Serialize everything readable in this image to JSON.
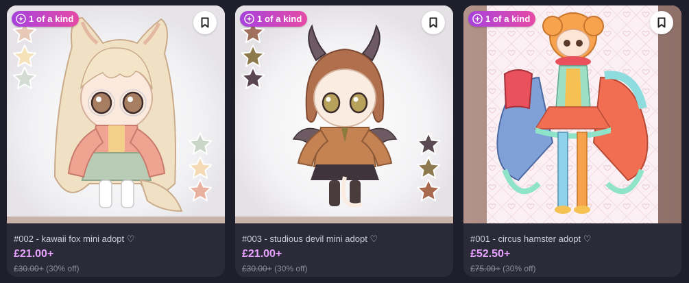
{
  "theme": {
    "background": "#1f1e2b",
    "card": "#2b2a38",
    "price_color": "#e7a3ff",
    "badge_gradient_start": "#a742dc",
    "badge_gradient_end": "#e64ba6"
  },
  "listings": [
    {
      "badge": "1 of a kind",
      "badge_icon": "sparkle-icon",
      "save_icon": "bookmark-icon",
      "title": "#002 - kawaii fox mini adopt ♡",
      "price": "£21.00+",
      "original_price": "£30.00+",
      "discount": "(30% off)",
      "thumbnail": "kawaii fox character illustration",
      "swatch_colors": [
        "#e8c9b8",
        "#f6e2b9",
        "#d3dbd2",
        "#c9d6c8",
        "#f6d9b5",
        "#e9b2a0"
      ]
    },
    {
      "badge": "1 of a kind",
      "badge_icon": "sparkle-icon",
      "save_icon": "bookmark-icon",
      "title": "#003 - studious devil mini adopt ♡",
      "price": "£21.00+",
      "original_price": "£30.00+",
      "discount": "(30% off)",
      "thumbnail": "studious devil character illustration",
      "swatch_colors": [
        "#a0705c",
        "#8c7a4c",
        "#5a4650",
        "#5b4a52",
        "#8f7a4f",
        "#a8694f"
      ]
    },
    {
      "badge": "1 of a kind",
      "badge_icon": "sparkle-icon",
      "save_icon": "bookmark-icon",
      "title": "#001 - circus hamster adopt ♡",
      "price": "£52.50+",
      "original_price": "£75.00+",
      "discount": "(30% off)",
      "thumbnail": "circus hamster character illustration",
      "swatch_colors": []
    }
  ]
}
